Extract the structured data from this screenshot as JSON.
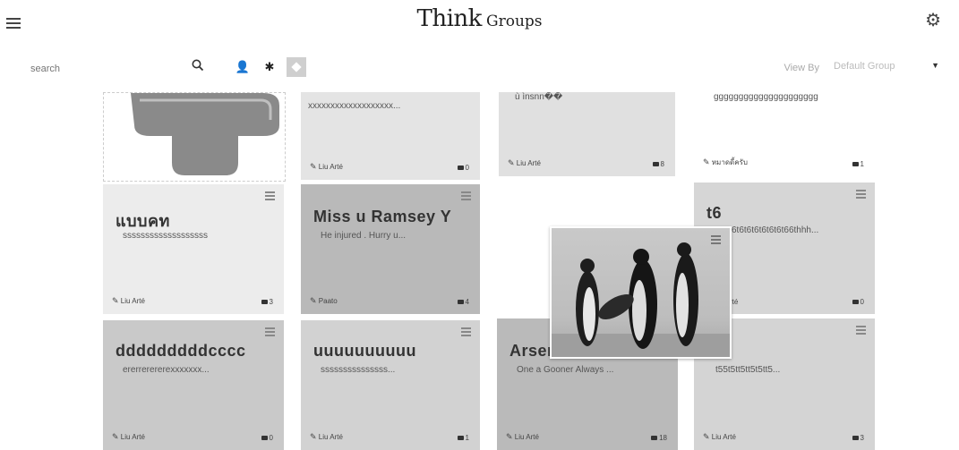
{
  "header": {
    "brand_bold": "Think",
    "brand_small": "Groups",
    "menu_icon": "hamburger-menu-icon",
    "settings_icon": "gear-icon"
  },
  "toolbar": {
    "search_placeholder": "search",
    "search_icon": "search-icon",
    "filter_icons": [
      "user-icon",
      "asterisk-icon",
      "square-icon"
    ],
    "view_by_label": "View By",
    "group_select_value": "Default Group"
  },
  "cards": [
    {
      "title": "",
      "desc": "xxxxxxxxxxxxxxxxxxx...",
      "author": "Liu Arté",
      "comments": "0"
    },
    {
      "title": "",
      "desc": "ù ìnsnn��",
      "author": "Liu Arté",
      "comments": "8"
    },
    {
      "title": "",
      "desc": "ggggggggggggggggggggg",
      "author": "หมาดดี้ครับ",
      "comments": "1"
    },
    {
      "title": "แบบคท",
      "desc": "sssssssssssssssssss",
      "author": "Liu Arté",
      "comments": "3"
    },
    {
      "title": "Miss u Ramsey Y",
      "desc": "He injured . Hurry u...",
      "author": "Paato",
      "comments": "4"
    },
    {
      "title": "t6",
      "desc": "6t6t6t6t6t6t6t66thhh...",
      "author": "rté",
      "comments": "0"
    },
    {
      "title": "dddddddddcccc",
      "desc": "ererrerererexxxxxxx...",
      "author": "Liu Arté",
      "comments": "0"
    },
    {
      "title": "uuuuuuuuuu",
      "desc": "sssssssssssssss...",
      "author": "Liu Arté",
      "comments": "1"
    },
    {
      "title": "Arser",
      "desc": "One a Gooner Always ...",
      "author": "Liu Arté",
      "comments": "18"
    },
    {
      "title": "",
      "desc": "t55t5tt5tt5t5tt5...",
      "author": "Liu Arté",
      "comments": "3"
    }
  ]
}
